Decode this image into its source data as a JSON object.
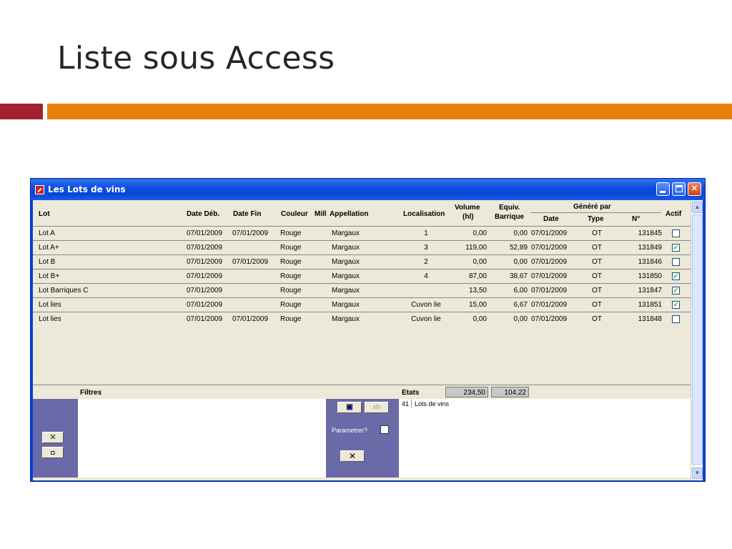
{
  "slide": {
    "title": "Liste sous Access"
  },
  "window": {
    "title": "Les Lots de vins",
    "minimize": "_",
    "close": "✕"
  },
  "columns": {
    "lot": "Lot",
    "date_deb": "Date Déb.",
    "date_fin": "Date Fin",
    "couleur": "Couleur",
    "mill": "Mill",
    "appellation": "Appellation",
    "localisation": "Localisation",
    "volume_1": "Volume",
    "volume_2": "(hl)",
    "equiv_1": "Equiv.",
    "equiv_2": "Barrique",
    "genere_par": "Généré par",
    "date": "Date",
    "type": "Type",
    "numero": "N°",
    "actif": "Actif"
  },
  "rows": [
    {
      "lot": "Lot A",
      "date_deb": "07/01/2009",
      "date_fin": "07/01/2009",
      "couleur": "Rouge",
      "appellation": "Margaux",
      "localisation": "1",
      "volume": "0,00",
      "equiv": "0,00",
      "date": "07/01/2009",
      "type": "OT",
      "numero": "131845",
      "actif": ""
    },
    {
      "lot": "Lot A+",
      "date_deb": "07/01/2009",
      "date_fin": "",
      "couleur": "Rouge",
      "appellation": "Margaux",
      "localisation": "3",
      "volume": "119,00",
      "equiv": "52,89",
      "date": "07/01/2009",
      "type": "OT",
      "numero": "131849",
      "actif": "✓"
    },
    {
      "lot": "Lot B",
      "date_deb": "07/01/2009",
      "date_fin": "07/01/2009",
      "couleur": "Rouge",
      "appellation": "Margaux",
      "localisation": "2",
      "volume": "0,00",
      "equiv": "0,00",
      "date": "07/01/2009",
      "type": "OT",
      "numero": "131846",
      "actif": ""
    },
    {
      "lot": "Lot B+",
      "date_deb": "07/01/2009",
      "date_fin": "",
      "couleur": "Rouge",
      "appellation": "Margaux",
      "localisation": "4",
      "volume": "87,00",
      "equiv": "38,67",
      "date": "07/01/2009",
      "type": "OT",
      "numero": "131850",
      "actif": "✓"
    },
    {
      "lot": "Lot Barriques C",
      "date_deb": "07/01/2009",
      "date_fin": "",
      "couleur": "Rouge",
      "appellation": "Margaux",
      "localisation": "",
      "volume": "13,50",
      "equiv": "6,00",
      "date": "07/01/2009",
      "type": "OT",
      "numero": "131847",
      "actif": "✓"
    },
    {
      "lot": "Lot lies",
      "date_deb": "07/01/2009",
      "date_fin": "",
      "couleur": "Rouge",
      "appellation": "Margaux",
      "localisation": "Cuvon lie",
      "volume": "15,00",
      "equiv": "6,67",
      "date": "07/01/2009",
      "type": "OT",
      "numero": "131851",
      "actif": "✓"
    },
    {
      "lot": "Lot lies",
      "date_deb": "07/01/2009",
      "date_fin": "07/01/2009",
      "couleur": "Rouge",
      "appellation": "Margaux",
      "localisation": "Cuvon lie",
      "volume": "0,00",
      "equiv": "0,00",
      "date": "07/01/2009",
      "type": "OT",
      "numero": "131848",
      "actif": ""
    }
  ],
  "footer": {
    "filtres": "Filtres",
    "etats": "Etats",
    "total_volume": "234,50",
    "total_equiv": "104,22",
    "parametrer": "Parametrer?",
    "close_label": "✕",
    "xls_label": "xls",
    "report_id": "41",
    "report_name": "Lots de vins"
  }
}
